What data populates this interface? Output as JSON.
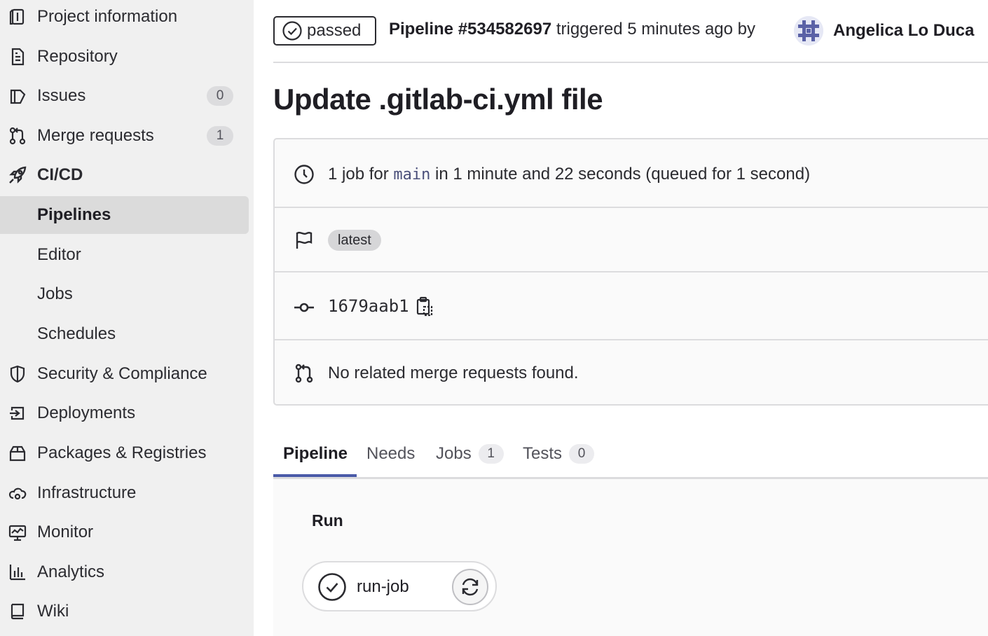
{
  "sidebar": {
    "items": [
      {
        "label": "Project information",
        "icon": "project-information-icon"
      },
      {
        "label": "Repository",
        "icon": "document-icon"
      },
      {
        "label": "Issues",
        "icon": "issues-icon",
        "count": "0"
      },
      {
        "label": "Merge requests",
        "icon": "merge-request-icon",
        "count": "1"
      },
      {
        "label": "CI/CD",
        "icon": "rocket-icon"
      },
      {
        "label": "Pipelines"
      },
      {
        "label": "Editor"
      },
      {
        "label": "Jobs"
      },
      {
        "label": "Schedules"
      },
      {
        "label": "Security & Compliance",
        "icon": "shield-icon"
      },
      {
        "label": "Deployments",
        "icon": "deployments-icon"
      },
      {
        "label": "Packages & Registries",
        "icon": "package-icon"
      },
      {
        "label": "Infrastructure",
        "icon": "cloud-gear-icon"
      },
      {
        "label": "Monitor",
        "icon": "monitor-icon"
      },
      {
        "label": "Analytics",
        "icon": "chart-icon"
      },
      {
        "label": "Wiki",
        "icon": "book-icon"
      }
    ]
  },
  "header": {
    "status": "passed",
    "pipeline_id": "Pipeline #534582697",
    "triggered_text": " triggered 5 minutes ago by",
    "author": "Angelica Lo Duca"
  },
  "title": "Update .gitlab-ci.yml file",
  "info": {
    "jobs_prefix": "1 job for ",
    "branch": "main",
    "jobs_suffix": " in 1 minute and 22 seconds (queued for 1 second)",
    "tag": "latest",
    "commit_sha": "1679aab1",
    "merge_requests": "No related merge requests found."
  },
  "tabs": [
    {
      "label": "Pipeline"
    },
    {
      "label": "Needs"
    },
    {
      "label": "Jobs",
      "count": "1"
    },
    {
      "label": "Tests",
      "count": "0"
    }
  ],
  "graph": {
    "stage": "Run",
    "job": "run-job"
  },
  "colors": {
    "sidebar_bg": "#f0f0f0",
    "active_item_bg": "#dbdbdb",
    "tab_accent": "#4a5aa8",
    "branch_mono": "#4a4f7a"
  }
}
